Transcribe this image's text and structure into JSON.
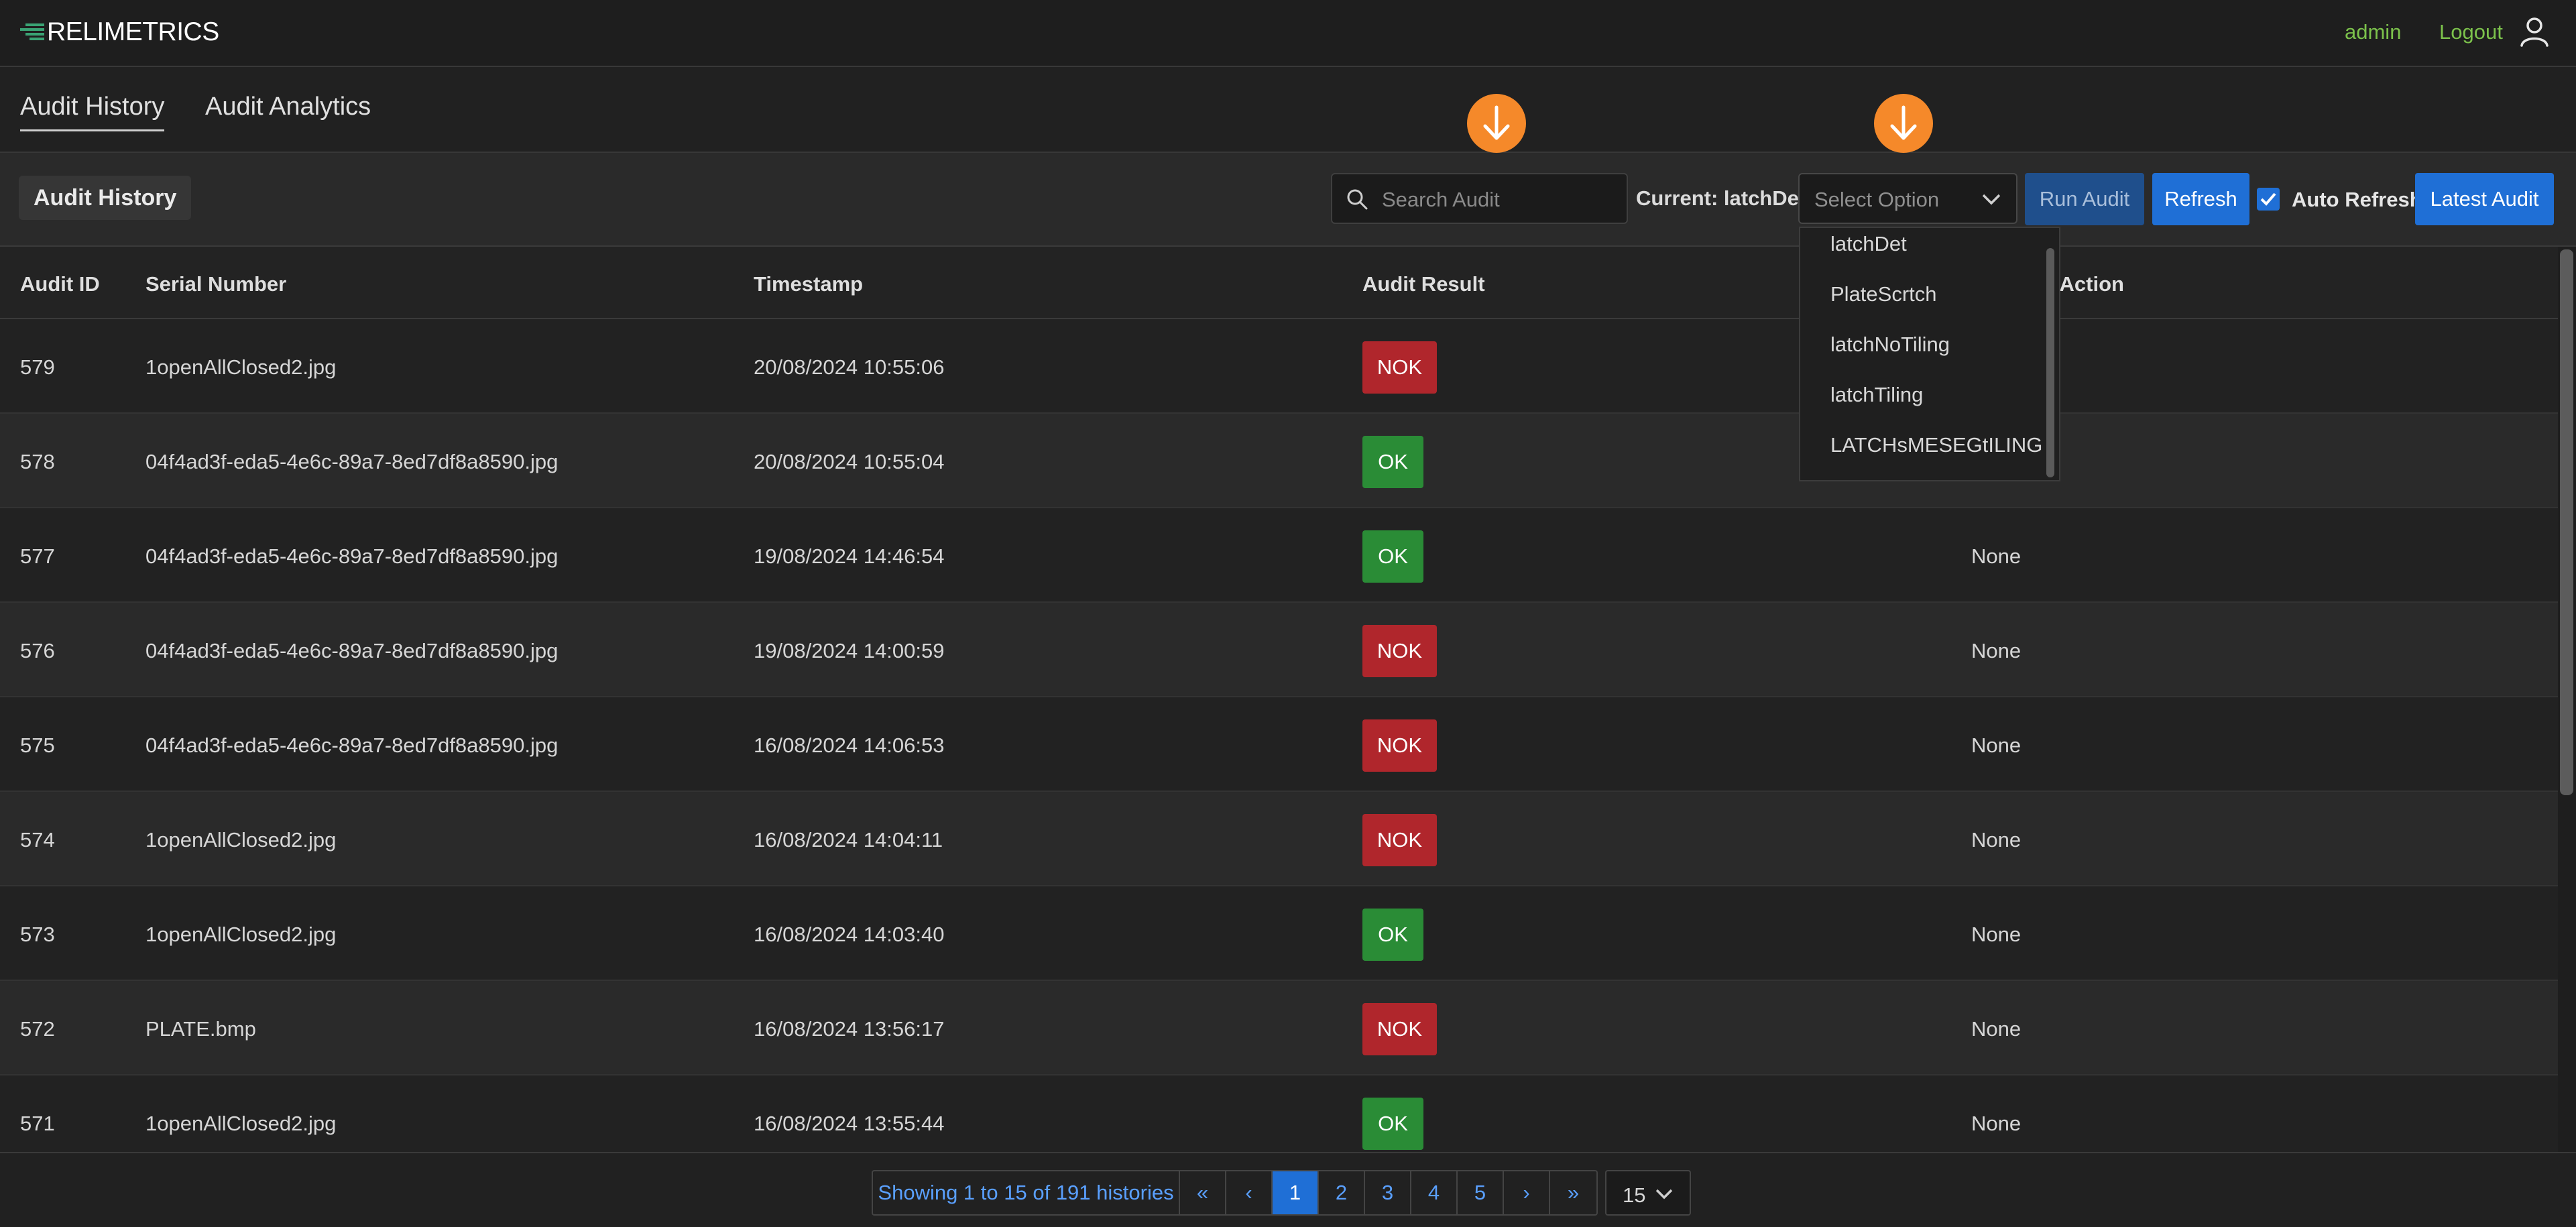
{
  "header": {
    "logo_text": "RELIMETRICS",
    "username": "admin",
    "logout_label": "Logout"
  },
  "tabs": [
    {
      "label": "Audit History",
      "active": true
    },
    {
      "label": "Audit Analytics",
      "active": false
    }
  ],
  "toolbar": {
    "section_title": "Audit History",
    "search_placeholder": "Search Audit",
    "current_label": "Current: latchDet",
    "select_placeholder": "Select Option",
    "run_audit_label": "Run Audit",
    "refresh_label": "Refresh",
    "auto_refresh_label": "Auto Refresh",
    "auto_refresh_checked": true,
    "latest_audit_label": "Latest Audit"
  },
  "dropdown": {
    "options": [
      "latchDet",
      "PlateScrtch",
      "latchNoTiling",
      "latchTiling",
      "LATCHsMESEGtILING"
    ]
  },
  "table": {
    "columns": [
      "Audit ID",
      "Serial Number",
      "Timestamp",
      "Audit Result",
      "r Action"
    ],
    "rows": [
      {
        "id": "579",
        "serial": "1openAllClosed2.jpg",
        "timestamp": "20/08/2024 10:55:06",
        "result": "NOK",
        "action": ""
      },
      {
        "id": "578",
        "serial": "04f4ad3f-eda5-4e6c-89a7-8ed7df8a8590.jpg",
        "timestamp": "20/08/2024 10:55:04",
        "result": "OK",
        "action": ""
      },
      {
        "id": "577",
        "serial": "04f4ad3f-eda5-4e6c-89a7-8ed7df8a8590.jpg",
        "timestamp": "19/08/2024 14:46:54",
        "result": "OK",
        "action": "None"
      },
      {
        "id": "576",
        "serial": "04f4ad3f-eda5-4e6c-89a7-8ed7df8a8590.jpg",
        "timestamp": "19/08/2024 14:00:59",
        "result": "NOK",
        "action": "None"
      },
      {
        "id": "575",
        "serial": "04f4ad3f-eda5-4e6c-89a7-8ed7df8a8590.jpg",
        "timestamp": "16/08/2024 14:06:53",
        "result": "NOK",
        "action": "None"
      },
      {
        "id": "574",
        "serial": "1openAllClosed2.jpg",
        "timestamp": "16/08/2024 14:04:11",
        "result": "NOK",
        "action": "None"
      },
      {
        "id": "573",
        "serial": "1openAllClosed2.jpg",
        "timestamp": "16/08/2024 14:03:40",
        "result": "OK",
        "action": "None"
      },
      {
        "id": "572",
        "serial": "PLATE.bmp",
        "timestamp": "16/08/2024 13:56:17",
        "result": "NOK",
        "action": "None"
      },
      {
        "id": "571",
        "serial": "1openAllClosed2.jpg",
        "timestamp": "16/08/2024 13:55:44",
        "result": "OK",
        "action": "None"
      }
    ]
  },
  "pagination": {
    "info": "Showing 1 to 15 of 191 histories",
    "first": "«",
    "prev": "‹",
    "pages": [
      "1",
      "2",
      "3",
      "4",
      "5"
    ],
    "active_page": "1",
    "next": "›",
    "last": "»",
    "per_page": "15"
  },
  "colors": {
    "accent_blue": "#1f6fd6",
    "nok_red": "#b0262c",
    "ok_green": "#2a8c36",
    "user_green": "#7cc24c",
    "annotation_orange": "#f5892a"
  },
  "icons": {
    "logo": "relimetrics-logo-icon",
    "user": "user-icon",
    "search": "search-icon",
    "select": "chevron-down-icon",
    "check": "check-icon",
    "annotation": "arrow-down-circle-icon"
  }
}
